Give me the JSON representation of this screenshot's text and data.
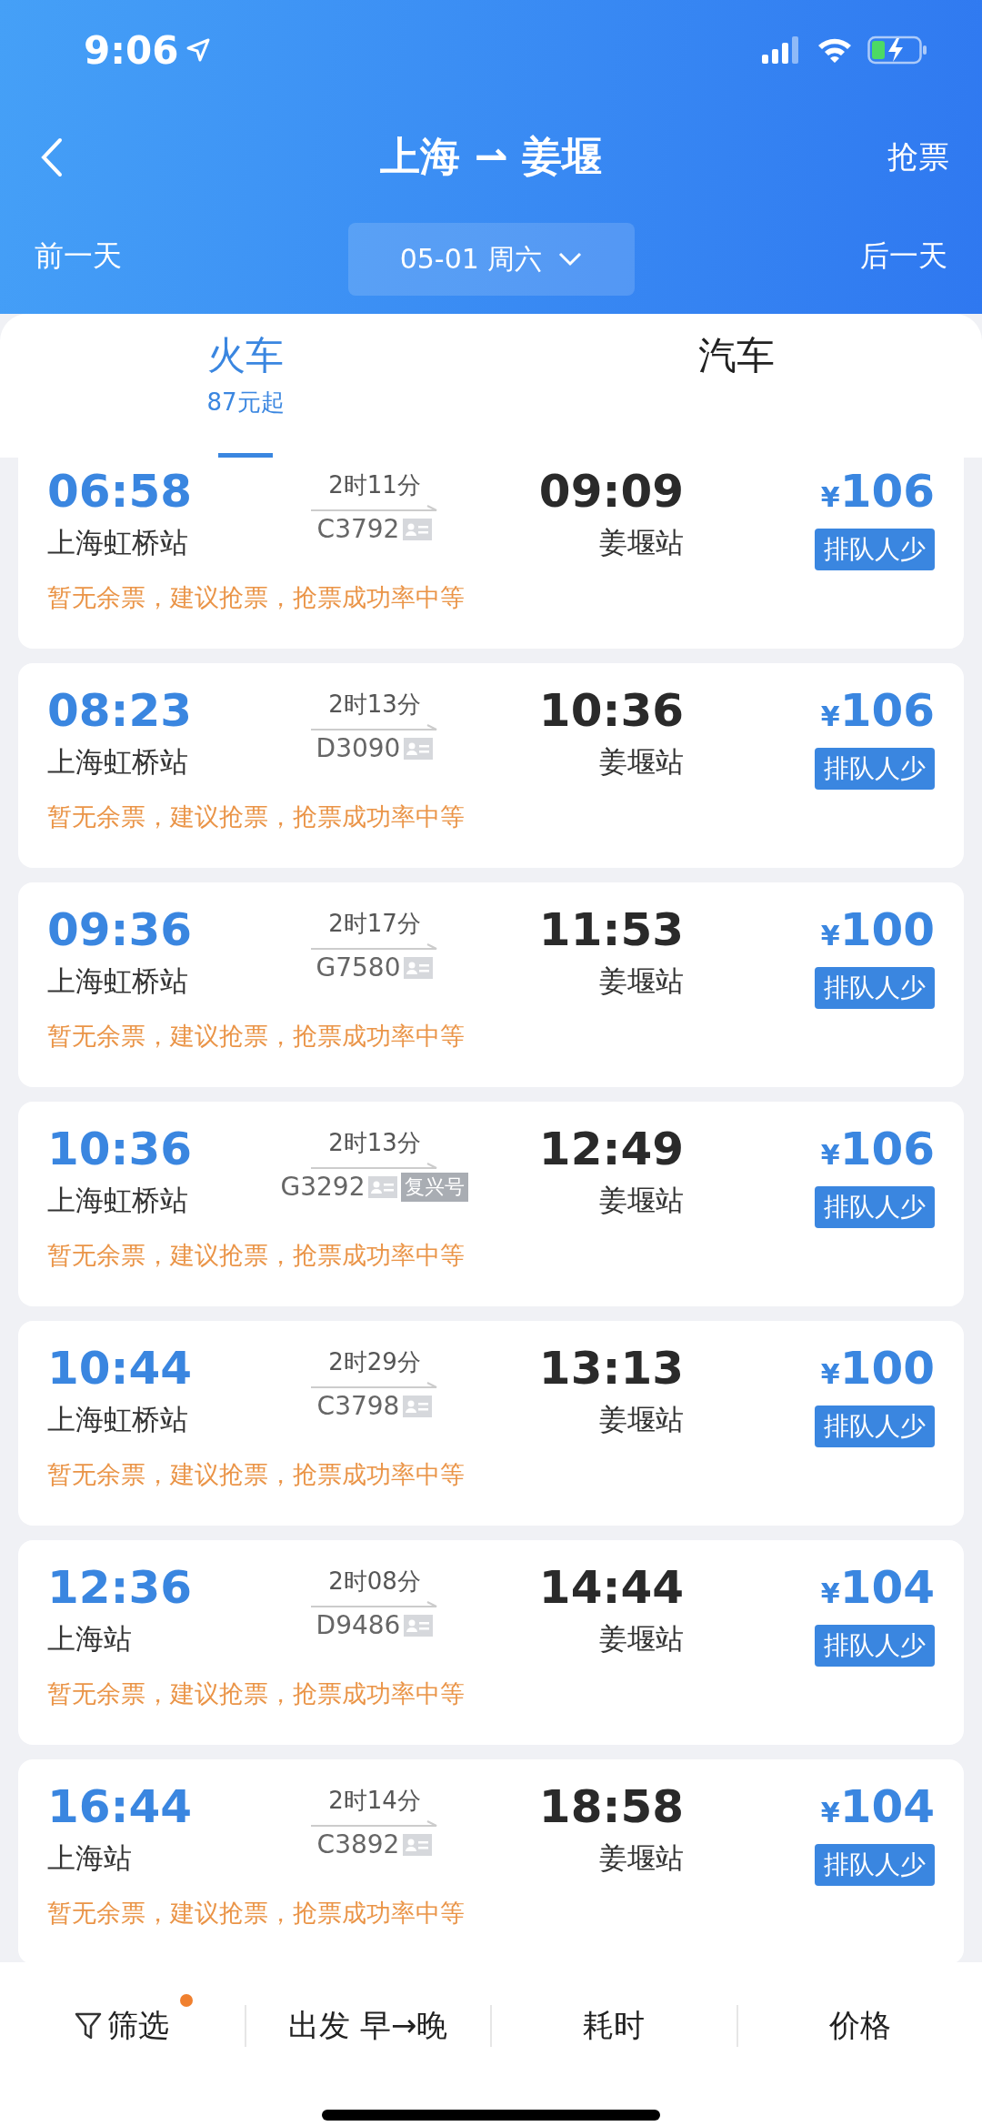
{
  "status_bar": {
    "time": "9:06"
  },
  "nav": {
    "title": "上海 ⇀ 姜堰",
    "action": "抢票"
  },
  "date_bar": {
    "prev": "前一天",
    "date": "05-01 周六",
    "next": "后一天"
  },
  "tabs": [
    {
      "label": "火车",
      "sub": "87元起",
      "selected": true
    },
    {
      "label": "汽车",
      "selected": false
    }
  ],
  "trains": [
    {
      "depart": "06:58",
      "from": "上海虹桥站",
      "duration": "2时11分",
      "number": "C3792",
      "arrive": "09:09",
      "to": "姜堰站",
      "currency": "¥",
      "price": "106",
      "status": "排队人少",
      "note": "暂无余票，建议抢票，抢票成功率中等"
    },
    {
      "depart": "08:23",
      "from": "上海虹桥站",
      "duration": "2时13分",
      "number": "D3090",
      "arrive": "10:36",
      "to": "姜堰站",
      "currency": "¥",
      "price": "106",
      "status": "排队人少",
      "note": "暂无余票，建议抢票，抢票成功率中等"
    },
    {
      "depart": "09:36",
      "from": "上海虹桥站",
      "duration": "2时17分",
      "number": "G7580",
      "arrive": "11:53",
      "to": "姜堰站",
      "currency": "¥",
      "price": "100",
      "status": "排队人少",
      "note": "暂无余票，建议抢票，抢票成功率中等"
    },
    {
      "depart": "10:36",
      "from": "上海虹桥站",
      "duration": "2时13分",
      "number": "G3292",
      "tags": [
        "复兴号"
      ],
      "arrive": "12:49",
      "to": "姜堰站",
      "currency": "¥",
      "price": "106",
      "status": "排队人少",
      "note": "暂无余票，建议抢票，抢票成功率中等"
    },
    {
      "depart": "10:44",
      "from": "上海虹桥站",
      "duration": "2时29分",
      "number": "C3798",
      "arrive": "13:13",
      "to": "姜堰站",
      "currency": "¥",
      "price": "100",
      "status": "排队人少",
      "note": "暂无余票，建议抢票，抢票成功率中等"
    },
    {
      "depart": "12:36",
      "from": "上海站",
      "duration": "2时08分",
      "number": "D9486",
      "arrive": "14:44",
      "to": "姜堰站",
      "currency": "¥",
      "price": "104",
      "status": "排队人少",
      "note": "暂无余票，建议抢票，抢票成功率中等"
    },
    {
      "depart": "16:44",
      "from": "上海站",
      "duration": "2时14分",
      "number": "C3892",
      "arrive": "18:58",
      "to": "姜堰站",
      "currency": "¥",
      "price": "104",
      "status": "排队人少",
      "note": "暂无余票，建议抢票，抢票成功率中等"
    }
  ],
  "sort_bar": [
    {
      "kind": "filter",
      "label": "筛选",
      "dot": true
    },
    {
      "kind": "sort",
      "label": "出发 早→晚"
    },
    {
      "kind": "sort",
      "label": "耗时"
    },
    {
      "kind": "sort",
      "label": "价格"
    }
  ]
}
